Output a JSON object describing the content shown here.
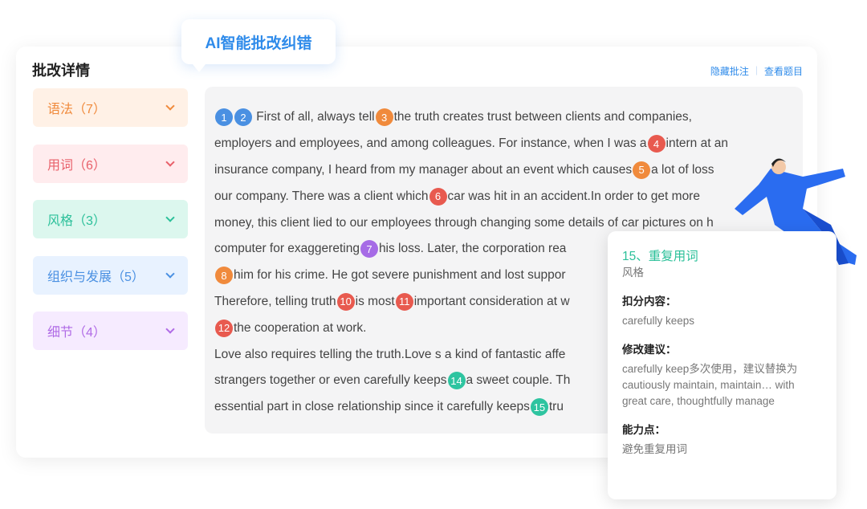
{
  "bubble": "AI智能批改纠错",
  "title": "批改详情",
  "links": {
    "hide": "隐藏批注",
    "view": "查看题目"
  },
  "categories": [
    {
      "label": "语法（7）",
      "color": "#f08a3c",
      "bg": "#fff1e6"
    },
    {
      "label": "用词（6）",
      "color": "#e8606a",
      "bg": "#ffecee"
    },
    {
      "label": "风格（3）",
      "color": "#2cc09a",
      "bg": "#dcf7ee"
    },
    {
      "label": "组织与发展（5）",
      "color": "#4a90e2",
      "bg": "#e8f2ff"
    },
    {
      "label": "细节（4）",
      "color": "#b06be6",
      "bg": "#f6ebff"
    }
  ],
  "markerColors": {
    "blue": "#4a90e2",
    "orange": "#f08a3c",
    "red": "#e85a4f",
    "purple": "#a66be6",
    "teal": "#2ec4a0"
  },
  "essay": [
    [
      {
        "m": "1",
        "c": "blue"
      },
      {
        "m": "2",
        "c": "blue"
      },
      {
        "t": " First of all, always tell"
      },
      {
        "m": "3",
        "c": "orange"
      },
      {
        "t": "the truth creates trust between clients and companies,"
      }
    ],
    [
      {
        "t": "employers and employees, and among colleagues. For instance, when I was a"
      },
      {
        "m": "4",
        "c": "red"
      },
      {
        "t": "intern at an"
      }
    ],
    [
      {
        "t": "insurance company, I heard from my manager about an event which causes"
      },
      {
        "m": "5",
        "c": "orange"
      },
      {
        "t": "a lot of loss"
      }
    ],
    [
      {
        "t": "our company. There was a client which"
      },
      {
        "m": "6",
        "c": "red"
      },
      {
        "t": "car was hit in an accident.In order to get more"
      }
    ],
    [
      {
        "t": "money, this client lied to our employees through changing some details of car pictures on h"
      }
    ],
    [
      {
        "t": "computer for exaggereting"
      },
      {
        "m": "7",
        "c": "purple"
      },
      {
        "t": "his loss. Later, the corporation rea"
      }
    ],
    [
      {
        "m": "8",
        "c": "orange"
      },
      {
        "t": "him for his crime. He got severe punishment and lost suppor"
      }
    ],
    [
      {
        "t": "Therefore, telling truth"
      },
      {
        "m": "10",
        "c": "red"
      },
      {
        "t": "is most"
      },
      {
        "m": "11",
        "c": "red"
      },
      {
        "t": "important consideration at w"
      }
    ],
    [
      {
        "m": "12",
        "c": "red"
      },
      {
        "t": "the cooperation at work."
      }
    ],
    [
      {
        "t": "Love also requires telling the truth.Love s a kind of fantastic affe"
      }
    ],
    [
      {
        "t": "strangers together or even carefully keeps"
      },
      {
        "m": "14",
        "c": "teal"
      },
      {
        "t": "a sweet couple. Th"
      }
    ],
    [
      {
        "t": "essential part in close relationship since it carefully keeps"
      },
      {
        "m": "15",
        "c": "teal"
      },
      {
        "t": "tru"
      }
    ]
  ],
  "popup": {
    "heading": "15、重复用词",
    "category": "风格",
    "deduct_label": "扣分内容：",
    "deduct": "carefully keeps",
    "suggest_label": "修改建议：",
    "suggest": "carefully keep多次使用，建议替换为cautiously maintain, maintain… with great care, thoughtfully manage",
    "ability_label": "能力点：",
    "ability": "避免重复用词"
  }
}
